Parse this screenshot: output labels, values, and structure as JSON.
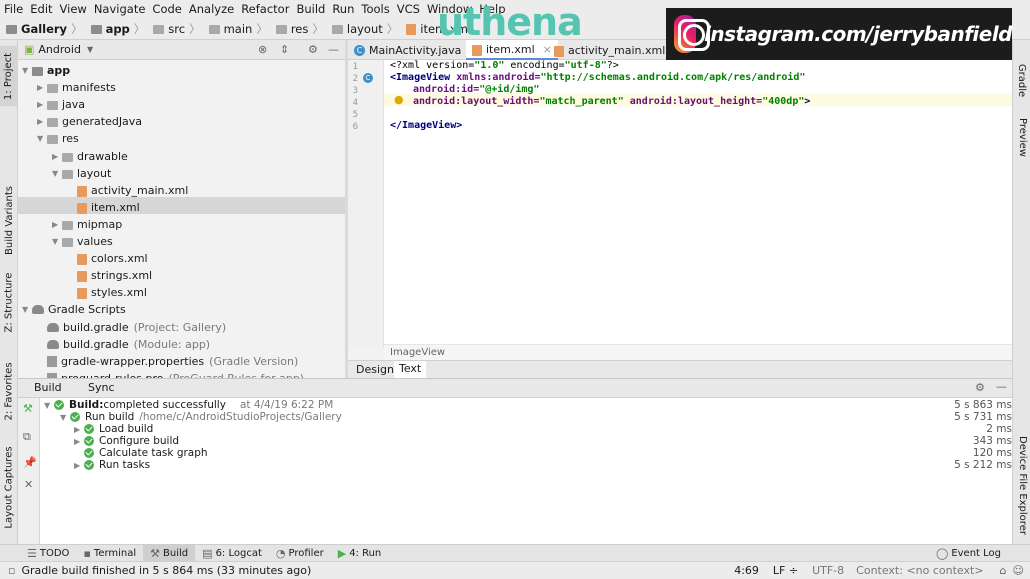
{
  "menu": [
    "File",
    "Edit",
    "View",
    "Navigate",
    "Code",
    "Analyze",
    "Refactor",
    "Build",
    "Run",
    "Tools",
    "VCS",
    "Window",
    "Help"
  ],
  "breadcrumbs": [
    "Gallery",
    "app",
    "src",
    "main",
    "res",
    "layout",
    "item.xml"
  ],
  "project": {
    "view": "Android",
    "tree": [
      {
        "label": "app",
        "level": 0,
        "kind": "folder",
        "expanded": true,
        "bold": true
      },
      {
        "label": "manifests",
        "level": 1,
        "kind": "folder",
        "expanded": false
      },
      {
        "label": "java",
        "level": 1,
        "kind": "folder",
        "expanded": false
      },
      {
        "label": "generatedJava",
        "level": 1,
        "kind": "folder",
        "expanded": false
      },
      {
        "label": "res",
        "level": 1,
        "kind": "folder",
        "expanded": true
      },
      {
        "label": "drawable",
        "level": 2,
        "kind": "folder",
        "expanded": false
      },
      {
        "label": "layout",
        "level": 2,
        "kind": "folder",
        "expanded": true
      },
      {
        "label": "activity_main.xml",
        "level": 3,
        "kind": "xml"
      },
      {
        "label": "item.xml",
        "level": 3,
        "kind": "xml",
        "selected": true
      },
      {
        "label": "mipmap",
        "level": 2,
        "kind": "folder",
        "expanded": false
      },
      {
        "label": "values",
        "level": 2,
        "kind": "folder",
        "expanded": true
      },
      {
        "label": "colors.xml",
        "level": 3,
        "kind": "xml"
      },
      {
        "label": "strings.xml",
        "level": 3,
        "kind": "xml"
      },
      {
        "label": "styles.xml",
        "level": 3,
        "kind": "xml"
      },
      {
        "label": "Gradle Scripts",
        "level": 0,
        "kind": "gradle",
        "expanded": true
      },
      {
        "label": "build.gradle",
        "level": 1,
        "kind": "gradle",
        "note": "(Project: Gallery)"
      },
      {
        "label": "build.gradle",
        "level": 1,
        "kind": "gradle",
        "note": "(Module: app)"
      },
      {
        "label": "gradle-wrapper.properties",
        "level": 1,
        "kind": "prop",
        "note": "(Gradle Version)"
      },
      {
        "label": "proguard-rules.pro",
        "level": 1,
        "kind": "prop",
        "note": "(ProGuard Rules for app)"
      }
    ]
  },
  "editor_tabs": [
    {
      "label": "MainActivity.java",
      "active": false
    },
    {
      "label": "item.xml",
      "active": true
    },
    {
      "label": "activity_main.xml",
      "active": false
    }
  ],
  "code": {
    "line_numbers": [
      "1",
      "2",
      "3",
      "4",
      "5",
      "6"
    ],
    "l1_a": "<?xml version=",
    "l1_b": "\"1.0\"",
    "l1_c": " encoding=",
    "l1_d": "\"utf-8\"",
    "l1_e": "?>",
    "l2_a": "<ImageView ",
    "l2_b": "xmlns:android=",
    "l2_c": "\"http://schemas.android.com/apk/res/android\"",
    "l3_a": "android:id=",
    "l3_b": "\"@+id/img\"",
    "l4_a": "android:layout_width=",
    "l4_b": "\"match_parent\"",
    "l4_c": " android:layout_height=",
    "l4_d": "\"400dp\"",
    "l4_e": ">",
    "l6": "</ImageView>"
  },
  "editor_breadcrumb": "ImageView",
  "design_tabs": [
    "Design",
    "Text"
  ],
  "build": {
    "tabs": [
      "Build",
      "Sync"
    ],
    "rows": [
      {
        "label": "Build:",
        "suffix": " completed successfully",
        "extra": "at 4/4/19 6:22 PM",
        "time": "5 s 863 ms"
      },
      {
        "label": "Run build",
        "suffix": "",
        "extra": "/home/c/AndroidStudioProjects/Gallery",
        "time": "5 s 731 ms"
      },
      {
        "label": "Load build",
        "suffix": "",
        "extra": "",
        "time": "2 ms"
      },
      {
        "label": "Configure build",
        "suffix": "",
        "extra": "",
        "time": "343 ms"
      },
      {
        "label": "Calculate task graph",
        "suffix": "",
        "extra": "",
        "time": "120 ms"
      },
      {
        "label": "Run tasks",
        "suffix": "",
        "extra": "",
        "time": "5 s 212 ms"
      }
    ]
  },
  "left_strip": [
    "1: Project",
    "Build Variants",
    "Z: Structure",
    "2: Favorites",
    "Layout Captures"
  ],
  "right_strip": [
    "Gradle",
    "Preview",
    "Device File Explorer"
  ],
  "bottom_tabs": [
    "TODO",
    "Terminal",
    "Build",
    "6: Logcat",
    "Profiler",
    "4: Run",
    "Event Log"
  ],
  "status": {
    "message": "Gradle build finished in 5 s 864 ms (33 minutes ago)",
    "position": "4:69",
    "line_sep": "LF ÷",
    "encoding": "UTF-8",
    "context": "Context: <no context>"
  },
  "overlay": {
    "brand": "uthena",
    "instagram": "instagram.com/jerrybanfield"
  },
  "colors": {
    "brand": "#55c4b0",
    "selection": "#d6d6d6",
    "success": "#4caf50",
    "accent": "#5d8fd0"
  }
}
